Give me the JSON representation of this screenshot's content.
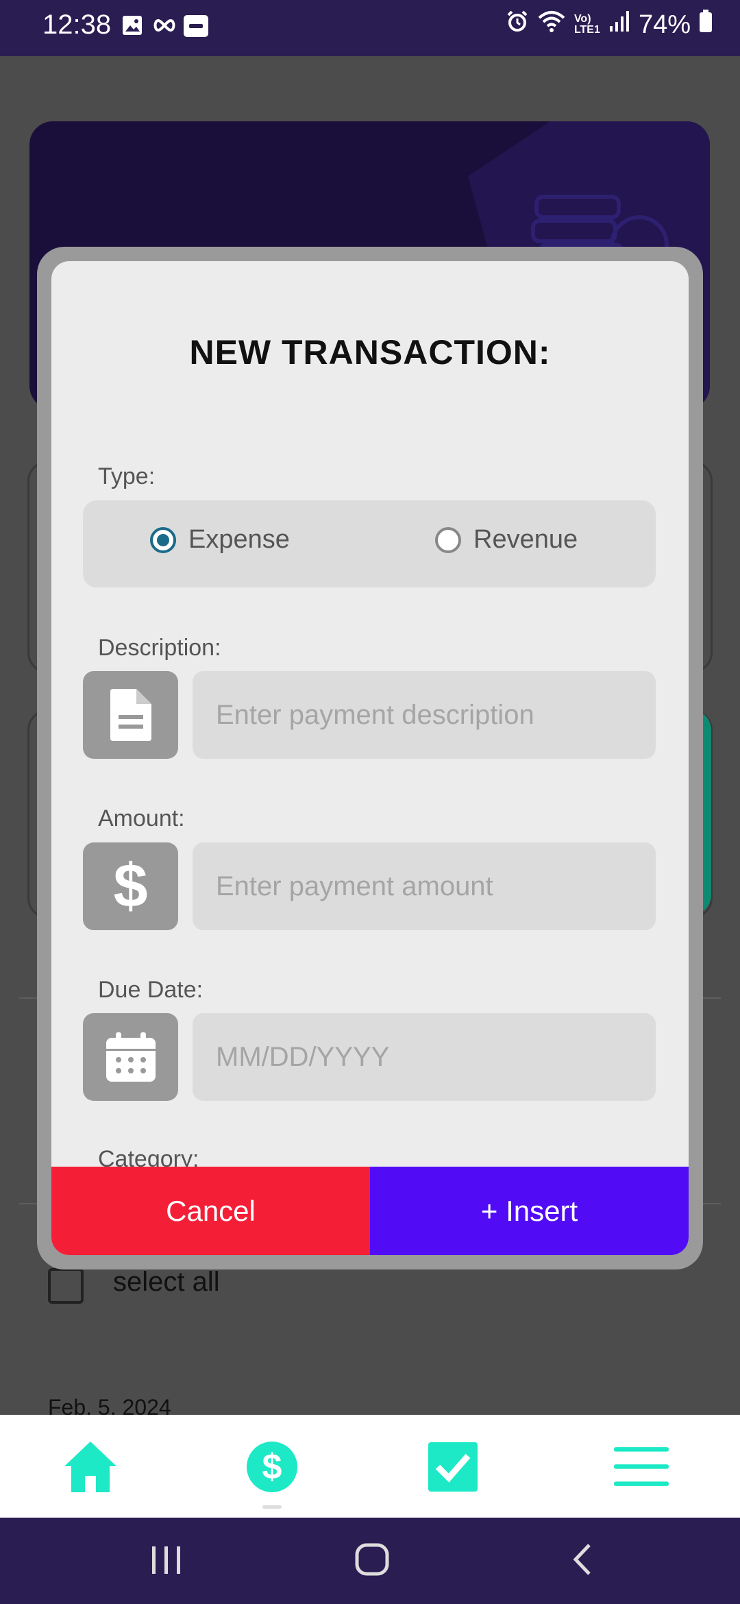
{
  "status_bar": {
    "time": "12:38",
    "battery": "74%",
    "network_label": "Vo) LTE1"
  },
  "background": {
    "select_all": "select all",
    "date": "Feb. 5, 2024"
  },
  "modal": {
    "title": "NEW TRANSACTION:",
    "type_label": "Type:",
    "type_options": [
      {
        "label": "Expense",
        "selected": true
      },
      {
        "label": "Revenue",
        "selected": false
      }
    ],
    "description_label": "Description:",
    "description_placeholder": "Enter payment description",
    "amount_label": "Amount:",
    "amount_placeholder": "Enter payment amount",
    "due_date_label": "Due Date:",
    "due_date_placeholder": "MM/DD/YYYY",
    "category_label": "Category:",
    "cancel_label": "Cancel",
    "insert_label": "+ Insert"
  },
  "bottom_nav": {
    "items": [
      {
        "icon": "home-icon"
      },
      {
        "icon": "dollar-icon"
      },
      {
        "icon": "checkbox-icon"
      },
      {
        "icon": "menu-icon"
      }
    ]
  },
  "colors": {
    "accent": "#1de9c6",
    "cancel": "#f41e36",
    "insert": "#520cf5",
    "status_bar": "#2a1d52"
  }
}
